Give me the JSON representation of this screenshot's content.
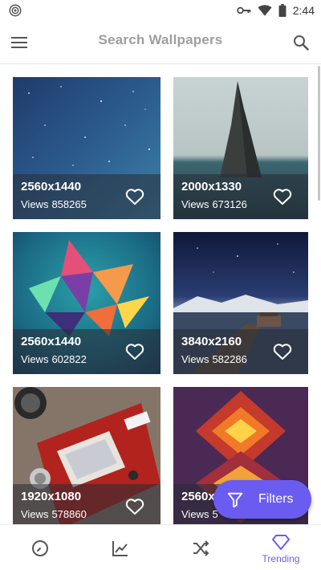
{
  "status_bar": {
    "time": "2:44",
    "icons": [
      "hotspot-icon",
      "key-icon",
      "wifi-icon",
      "battery-icon"
    ]
  },
  "app_bar": {
    "title": "Search Wallpapers",
    "icons": [
      "menu-icon",
      "search-icon"
    ]
  },
  "wallpapers": [
    {
      "resolution": "2560x1440",
      "views_label": "Views",
      "views": "858265",
      "subject": "starry night sky"
    },
    {
      "resolution": "2000x1330",
      "views_label": "Views",
      "views": "673126",
      "subject": "sea rock spire"
    },
    {
      "resolution": "2560x1440",
      "views_label": "Views",
      "views": "602822",
      "subject": "low-poly abstract"
    },
    {
      "resolution": "3840x2160",
      "views_label": "Views",
      "views": "582286",
      "subject": "pier under stars"
    },
    {
      "resolution": "1920x1080",
      "views_label": "Views",
      "views": "578860",
      "subject": "red handheld console"
    },
    {
      "resolution": "2560x",
      "views_label": "Views",
      "views": "5",
      "subject": "abstract geometric shapes"
    }
  ],
  "fab": {
    "label": "Filters",
    "icon": "filter-icon"
  },
  "bottom_nav": {
    "items": [
      {
        "icon": "clock-icon",
        "label": ""
      },
      {
        "icon": "chart-line-icon",
        "label": ""
      },
      {
        "icon": "shuffle-icon",
        "label": ""
      },
      {
        "icon": "diamond-icon",
        "label": "Trending",
        "active": true
      }
    ]
  },
  "colors": {
    "accent": "#6a5cf0",
    "title_gray": "#9e9e9e",
    "icon_gray": "#555555"
  }
}
